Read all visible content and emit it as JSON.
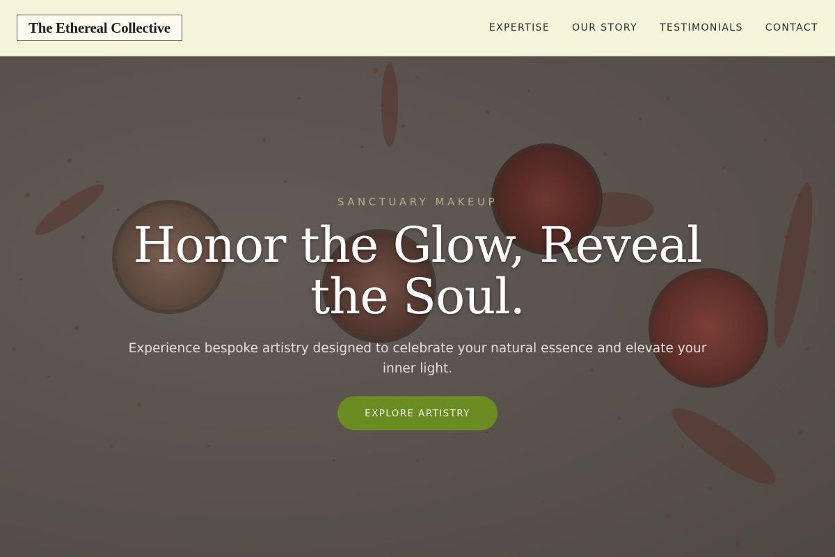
{
  "header": {
    "logo": "The Ethereal Collective",
    "nav": [
      "EXPERTISE",
      "OUR STORY",
      "TESTIMONIALS",
      "CONTACT"
    ]
  },
  "hero": {
    "eyebrow": "SANCTUARY MAKEUP",
    "headline_line1": "Honor the Glow, Reveal",
    "headline_line2": "the Soul.",
    "subtext": "Experience bespoke artistry designed to celebrate your natural essence and elevate your inner light.",
    "cta_label": "EXPLORE ARTISTRY",
    "background_image": "crushed-eyeshadow-powder-pans"
  },
  "colors": {
    "header_bg": "#f5f5dc",
    "accent_green": "#6b8c23",
    "eyebrow": "#b9ad8c"
  }
}
